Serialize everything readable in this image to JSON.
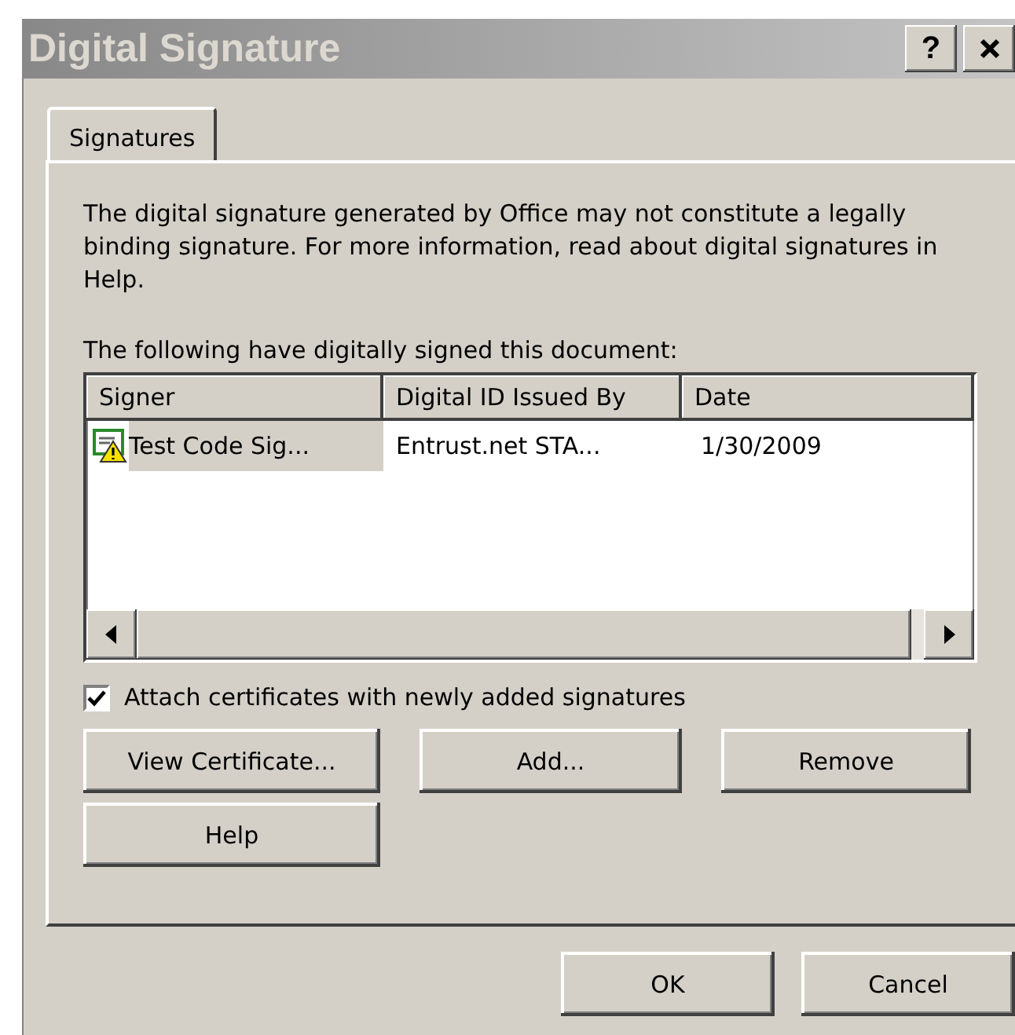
{
  "window": {
    "title": "Digital Signature",
    "help_button": "?"
  },
  "tabs": [
    {
      "label": "Signatures",
      "selected": true
    }
  ],
  "notice": "The digital signature generated by Office may not constitute a legally binding signature. For more information, read about digital signatures in Help.",
  "list_label": "The following have digitally signed this document:",
  "table": {
    "columns": [
      "Signer",
      "Digital ID Issued By",
      "Date"
    ],
    "rows": [
      {
        "signer": "Test Code Sig...",
        "issued_by": "Entrust.net STA...",
        "date": "1/30/2009",
        "selected": true
      }
    ]
  },
  "attach_checkbox": {
    "label": "Attach certificates with newly added signatures",
    "checked": true
  },
  "actions": [
    "View Certificate...",
    "Add...",
    "Remove",
    "Help"
  ],
  "footer_buttons": [
    "OK",
    "Cancel"
  ]
}
